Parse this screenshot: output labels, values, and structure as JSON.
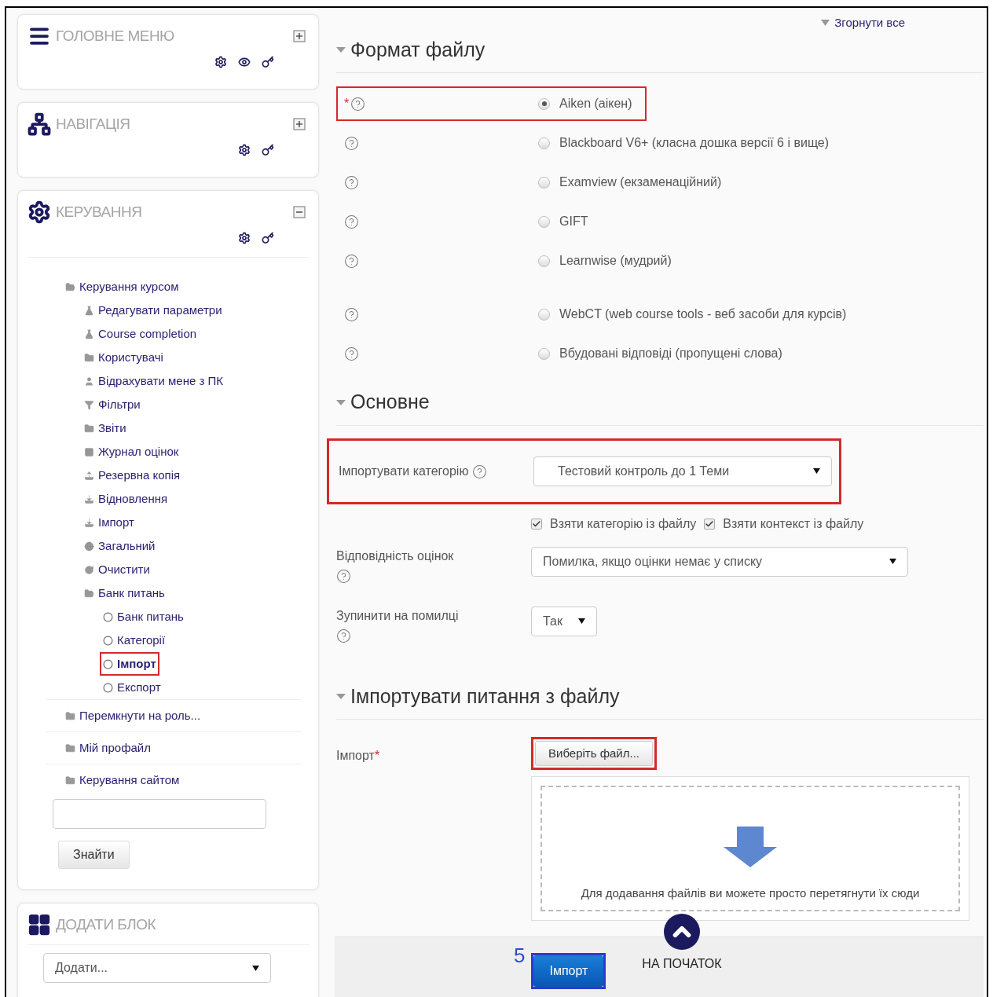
{
  "sidebar": {
    "blocks": [
      {
        "kind": "main-menu",
        "title": "ГОЛОВНЕ МЕНЮ",
        "collapsed": true
      },
      {
        "kind": "navigation",
        "title": "НАВІГАЦІЯ",
        "collapsed": true
      },
      {
        "kind": "administration",
        "title": "КЕРУВАННЯ",
        "collapsed": false,
        "tree": [
          {
            "label": "Керування курсом",
            "kind": "folder-open",
            "selected": false,
            "highlighted": false,
            "children": [
              {
                "label": "Редагувати параметри",
                "kind": "flask",
                "selected": false,
                "highlighted": false
              },
              {
                "label": "Course completion",
                "kind": "flask",
                "selected": false,
                "highlighted": false
              },
              {
                "label": "Користувачі",
                "kind": "folder",
                "selected": false,
                "highlighted": false
              },
              {
                "label": "Відрахувати мене з ПК",
                "kind": "user",
                "selected": false,
                "highlighted": false
              },
              {
                "label": "Фільтри",
                "kind": "filter",
                "selected": false,
                "highlighted": false
              },
              {
                "label": "Звіти",
                "kind": "folder",
                "selected": false,
                "highlighted": false
              },
              {
                "label": "Журнал оцінок",
                "kind": "table",
                "selected": false,
                "highlighted": false
              },
              {
                "label": "Резервна копія",
                "kind": "upload",
                "selected": false,
                "highlighted": false
              },
              {
                "label": "Відновлення",
                "kind": "download",
                "selected": false,
                "highlighted": false
              },
              {
                "label": "Імпорт",
                "kind": "download",
                "selected": false,
                "highlighted": false
              },
              {
                "label": "Загальний",
                "kind": "globe",
                "selected": false,
                "highlighted": false
              },
              {
                "label": "Очистити",
                "kind": "refresh",
                "selected": false,
                "highlighted": false
              },
              {
                "label": "Банк питань",
                "kind": "folder-open",
                "selected": false,
                "highlighted": false,
                "children": [
                  {
                    "label": "Банк питань",
                    "kind": "circle",
                    "selected": false,
                    "highlighted": false
                  },
                  {
                    "label": "Категорії",
                    "kind": "circle",
                    "selected": false,
                    "highlighted": false
                  },
                  {
                    "label": "Імпорт",
                    "kind": "circle",
                    "selected": true,
                    "highlighted": true
                  },
                  {
                    "label": "Експорт",
                    "kind": "circle",
                    "selected": false,
                    "highlighted": false
                  }
                ]
              }
            ]
          },
          {
            "label": "Перемкнути на роль...",
            "kind": "folder",
            "selected": false,
            "highlighted": false
          },
          {
            "label": "Мій профайл",
            "kind": "folder",
            "selected": false,
            "highlighted": false
          },
          {
            "label": "Керування сайтом",
            "kind": "folder",
            "selected": false,
            "highlighted": false
          }
        ],
        "search_button": "Знайти"
      },
      {
        "kind": "add-block",
        "title": "ДОДАТИ БЛОК",
        "select": "Додати..."
      }
    ]
  },
  "form": {
    "collapse_all": "Згорнути все",
    "sections": [
      {
        "kind": "formats",
        "title": "Формат файлу",
        "expanded": true,
        "options": [
          {
            "label": "Aiken (аікен)",
            "selected": true,
            "highlighted": true,
            "required_mark": "*"
          },
          {
            "label": "Blackboard V6+ (класна дошка версії 6 і вище)",
            "selected": false,
            "highlighted": false
          },
          {
            "label": "Examview (екзаменаційний)",
            "selected": false,
            "highlighted": false
          },
          {
            "label": "GIFT",
            "selected": false,
            "highlighted": false
          },
          {
            "label": "Learnwise (мудрий)",
            "selected": false,
            "highlighted": false
          },
          {
            "label": "WebCT (web course tools - веб засоби для курсів)",
            "selected": false,
            "highlighted": false
          },
          {
            "label": "Вбудовані відповіді (пропущені слова)",
            "selected": false,
            "highlighted": false
          }
        ]
      },
      {
        "kind": "general",
        "title": "Основне",
        "expanded": true,
        "category": {
          "label": "Імпортувати категорію",
          "value": "Тестовий контроль до 1 Теми",
          "highlighted": true
        },
        "checkboxes": [
          {
            "label": "Взяти категорію із файлу",
            "checked": true
          },
          {
            "label": "Взяти контекст із файлу",
            "checked": true
          }
        ],
        "grades": {
          "label": "Відповідність оцінок",
          "value": "Помилка, якщо оцінки немає у списку"
        },
        "stop": {
          "label": "Зупинити на помилці",
          "value": "Так"
        }
      },
      {
        "kind": "file",
        "title": "Імпортувати питання з файлу",
        "expanded": true,
        "label": "Імпорт",
        "required_mark": "*",
        "button": {
          "label": "Виберіть файл...",
          "highlighted": true
        },
        "dropzone": "Для додавання файлів ви можете просто перетягнути їх сюди"
      }
    ],
    "footer": {
      "step": "5",
      "submit": "Імпорт",
      "back_to_top": "НА ПОЧАТОК"
    }
  }
}
